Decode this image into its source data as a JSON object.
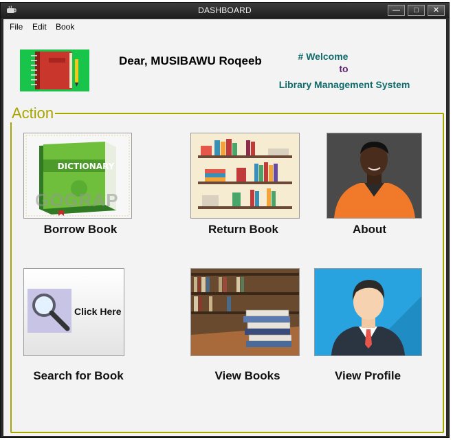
{
  "window": {
    "title": "DASHBOARD",
    "minimize_glyph": "—",
    "maximize_glyph": "□",
    "close_glyph": "✕"
  },
  "menu": {
    "items": [
      "File",
      "Edit",
      "Book"
    ]
  },
  "header": {
    "greeting": "Dear, MUSIBAWU Roqeeb",
    "welcome": "# Welcome",
    "to": "to",
    "system_name": "Library Management System"
  },
  "action_group": {
    "legend": "Action",
    "tiles": [
      {
        "caption": "Borrow Book",
        "icon": "dictionary-book-image",
        "image_text": "DICTIONARY",
        "watermark": "GOGRAP"
      },
      {
        "caption": "Return Book",
        "icon": "bookshelves-image"
      },
      {
        "caption": "About",
        "icon": "person-photo"
      },
      {
        "caption": "Search for Book",
        "icon": "magnifier-icon",
        "image_text": "Click Here"
      },
      {
        "caption": "View Books",
        "icon": "book-stack-library-image"
      },
      {
        "caption": "View Profile",
        "icon": "user-avatar-icon"
      }
    ]
  },
  "colors": {
    "accent": "#a8a400",
    "welcome": "#0f6b6b",
    "to": "#5a1f6b",
    "logo_bg": "#19c44a"
  }
}
